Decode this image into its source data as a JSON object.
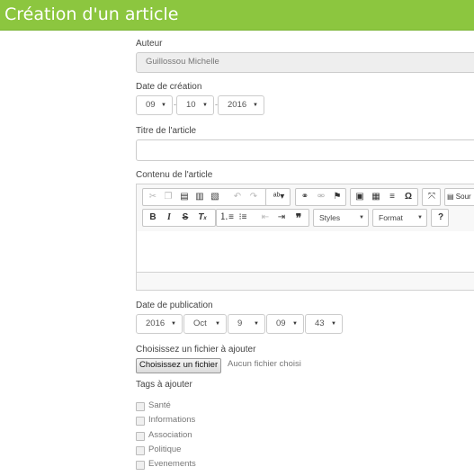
{
  "header": {
    "title": "Création d'un article"
  },
  "form": {
    "author_label": "Auteur",
    "author_value": "Guillossou Michelle",
    "creation_date_label": "Date de création",
    "creation_date": {
      "day": "09",
      "month": "10",
      "year": "2016",
      "separator": "-"
    },
    "title_label": "Titre de l'article",
    "title_value": "",
    "content_label": "Contenu de l'article",
    "editor": {
      "source_label": "Sour",
      "styles_label": "Styles",
      "format_label": "Format",
      "help_label": "?",
      "toolbar_row1": [
        {
          "name": "cut-icon",
          "glyph": "✂",
          "enabled": false
        },
        {
          "name": "copy-icon",
          "glyph": "⎘",
          "enabled": false
        },
        {
          "name": "paste-icon",
          "glyph": "📋",
          "enabled": true
        },
        {
          "name": "paste-text-icon",
          "glyph": "T",
          "enabled": true
        },
        {
          "name": "paste-word-icon",
          "glyph": "W",
          "enabled": true
        },
        {
          "name": "undo-icon",
          "glyph": "↶",
          "enabled": false
        },
        {
          "name": "redo-icon",
          "glyph": "↷",
          "enabled": false
        },
        {
          "name": "spellcheck-icon",
          "glyph": "✓",
          "enabled": true
        },
        {
          "name": "link-icon",
          "glyph": "∞",
          "enabled": true
        },
        {
          "name": "unlink-icon",
          "glyph": "⨯",
          "enabled": false
        },
        {
          "name": "anchor-icon",
          "glyph": "⚑",
          "enabled": true
        },
        {
          "name": "image-icon",
          "glyph": "▣",
          "enabled": true
        },
        {
          "name": "table-icon",
          "glyph": "▦",
          "enabled": true
        },
        {
          "name": "horizontal-rule-icon",
          "glyph": "≡",
          "enabled": true
        },
        {
          "name": "special-char-icon",
          "glyph": "Ω",
          "enabled": true
        },
        {
          "name": "maximize-icon",
          "glyph": "⤢",
          "enabled": true
        }
      ],
      "toolbar_row2": [
        {
          "name": "bold-icon",
          "glyph": "B",
          "enabled": true
        },
        {
          "name": "italic-icon",
          "glyph": "I",
          "enabled": true
        },
        {
          "name": "strike-icon",
          "glyph": "S",
          "enabled": true
        },
        {
          "name": "remove-format-icon",
          "glyph": "Tx",
          "enabled": true
        },
        {
          "name": "numbered-list-icon",
          "glyph": "⒈",
          "enabled": true
        },
        {
          "name": "bulleted-list-icon",
          "glyph": "•",
          "enabled": true
        },
        {
          "name": "outdent-icon",
          "glyph": "⇤",
          "enabled": false
        },
        {
          "name": "indent-icon",
          "glyph": "⇥",
          "enabled": true
        },
        {
          "name": "blockquote-icon",
          "glyph": "❞",
          "enabled": true
        }
      ]
    },
    "publication_date_label": "Date de publication",
    "publication_date": {
      "year": "2016",
      "month": "Oct",
      "day": "9",
      "hour": "09",
      "minute": "43"
    },
    "file_label": "Choisissez un fichier à ajouter",
    "file_button": "Choisissez un fichier",
    "file_status": "Aucun fichier choisi",
    "tags_label": "Tags à ajouter",
    "tags": [
      "Santé",
      "Informations",
      "Association",
      "Politique",
      "Evenements"
    ]
  },
  "colors": {
    "header_bg": "#8cc63f",
    "header_text": "#ffffff"
  }
}
